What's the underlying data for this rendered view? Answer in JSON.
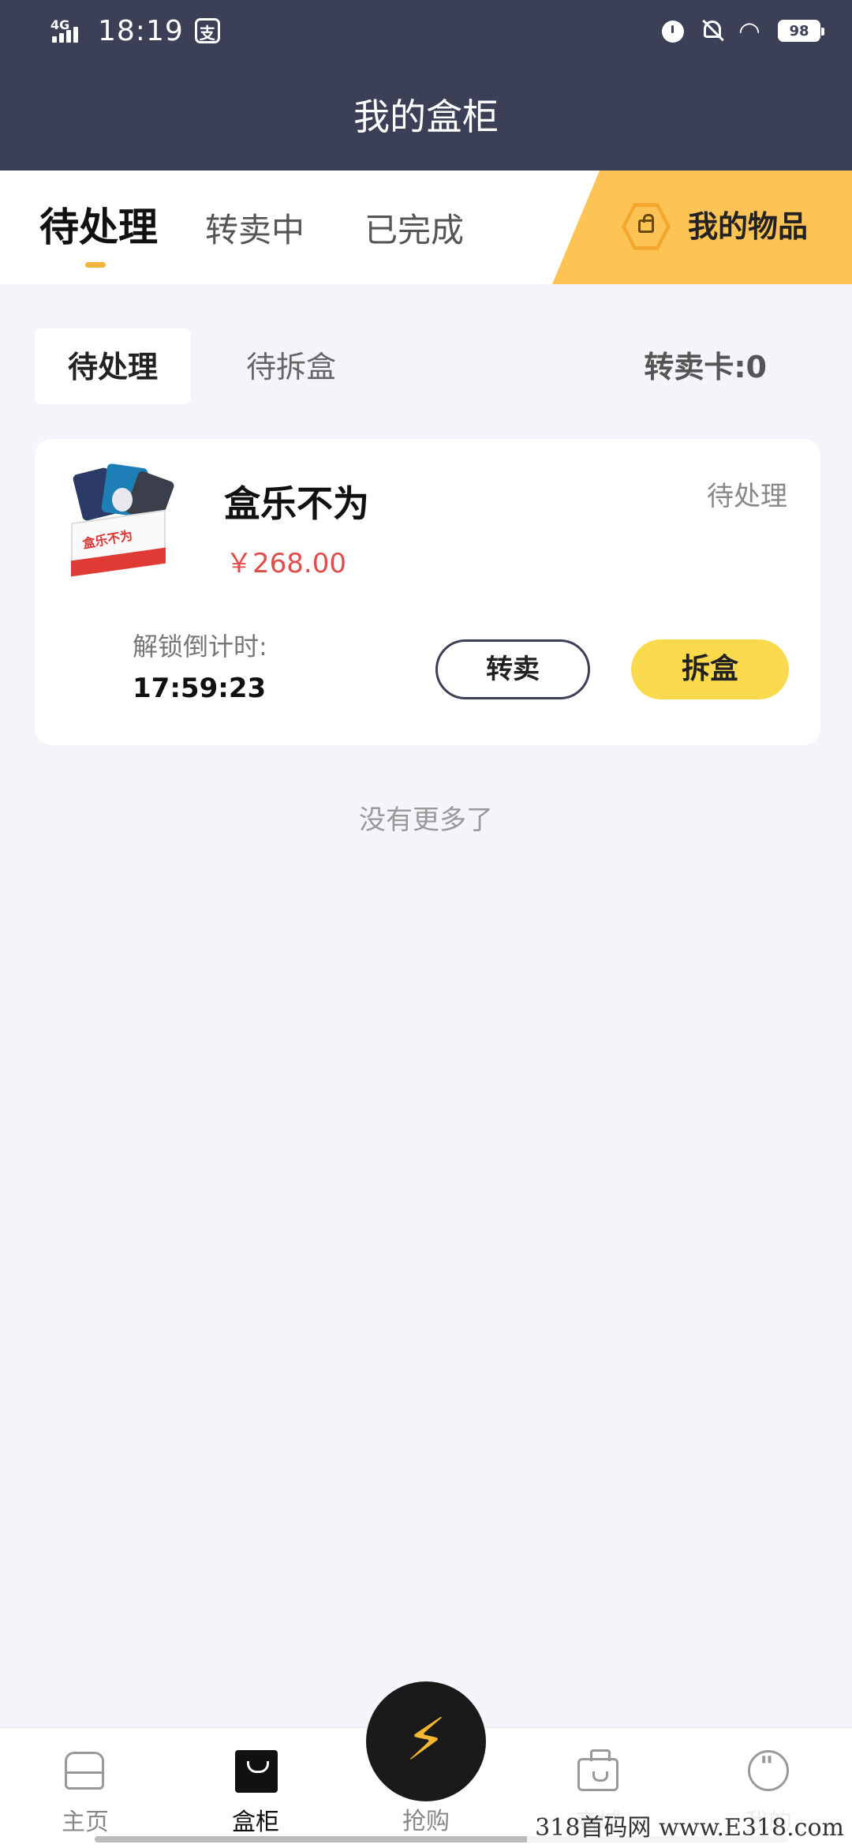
{
  "status_bar": {
    "network": "4G",
    "time": "18:19",
    "pay_icon": "支",
    "battery": "98"
  },
  "header": {
    "title": "我的盒柜"
  },
  "main_tabs": [
    {
      "label": "待处理"
    },
    {
      "label": "转卖中"
    },
    {
      "label": "已完成"
    }
  ],
  "my_items": {
    "label": "我的物品"
  },
  "sub_tabs": [
    {
      "label": "待处理"
    },
    {
      "label": "待拆盒"
    }
  ],
  "resale_card": "转卖卡:0",
  "order": {
    "name": "盒乐不为",
    "price": "￥268.00",
    "status": "待处理",
    "countdown_label": "解锁倒计时:",
    "countdown": "17:59:23",
    "resell_label": "转卖",
    "open_label": "拆盒",
    "box_logo": "盒乐不为"
  },
  "list_end": "没有更多了",
  "bottom_nav": [
    {
      "label": "主页"
    },
    {
      "label": "盒柜"
    },
    {
      "label": "抢购"
    },
    {
      "label": "商城"
    },
    {
      "label": "我的"
    }
  ],
  "watermark": "318首码网 www.E318.com",
  "colors": {
    "header_bg": "#3c4057",
    "accent_yellow": "#fbd94d",
    "my_items_bg": "#fdc355",
    "price_red": "#e24b4b"
  }
}
